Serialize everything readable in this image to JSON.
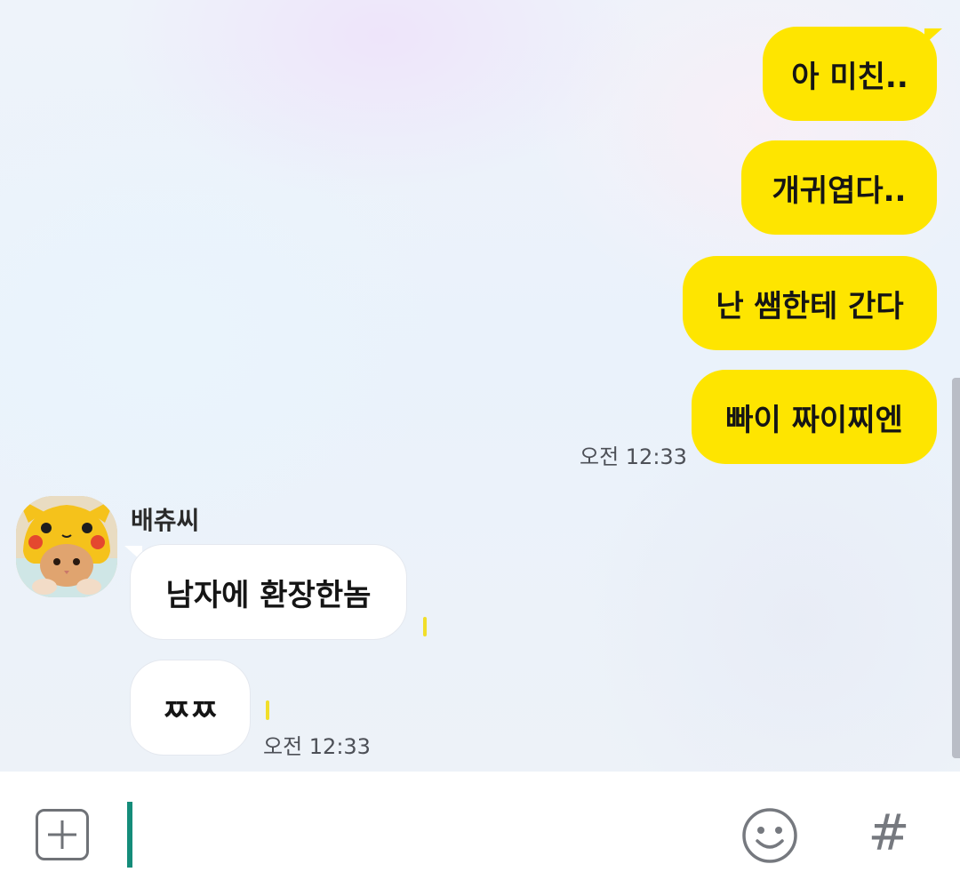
{
  "conversation": {
    "outgoing": [
      {
        "text": "아 미친.."
      },
      {
        "text": "개귀엽다.."
      },
      {
        "text": "난 쌤한테 간다"
      },
      {
        "text": "빠이 짜이찌엔"
      }
    ],
    "outgoing_time": "오전 12:33",
    "incoming_sender": "배츄씨",
    "incoming": [
      {
        "text": "남자에 환장한놈"
      },
      {
        "text": "ㅉㅉ"
      }
    ],
    "incoming_time": "오전 12:33"
  },
  "input_bar": {
    "left_icon": "plus-icon",
    "right_icons": [
      "emoji-icon",
      "hash-icon"
    ],
    "hash_glyph": "#"
  },
  "colors": {
    "my_bubble": "#fee500",
    "their_bubble": "#ffffff",
    "cursor": "#148c7a",
    "background": "#eaf2fb"
  }
}
